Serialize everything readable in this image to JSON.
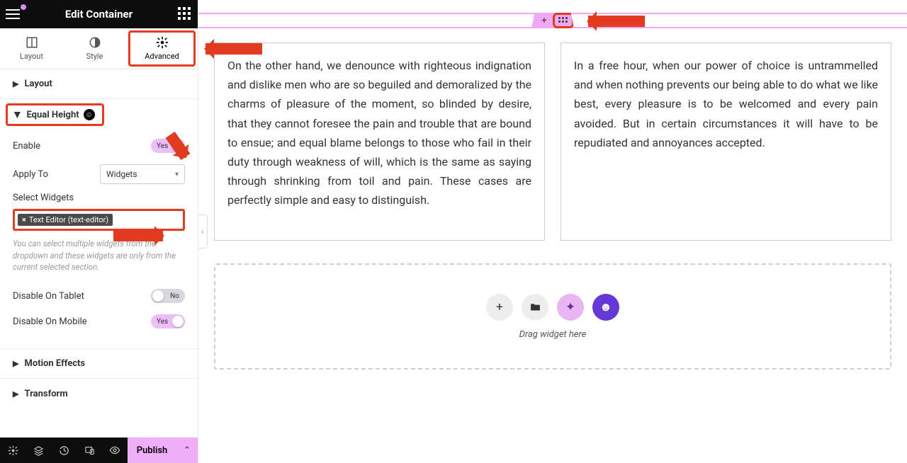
{
  "header": {
    "title": "Edit Container"
  },
  "tabs": {
    "layout": "Layout",
    "style": "Style",
    "advanced": "Advanced",
    "active": "advanced"
  },
  "sections": {
    "layout": "Layout",
    "equal_height": "Equal Height",
    "motion_effects": "Motion Effects",
    "transform": "Transform"
  },
  "equal_height": {
    "enable_label": "Enable",
    "enable_value": "Yes",
    "apply_to_label": "Apply To",
    "apply_to_value": "Widgets",
    "select_widgets_label": "Select Widgets",
    "chip": "Text Editor (text-editor)",
    "help": "You can select multiple widgets from the dropdown and these widgets are only from the current selected section.",
    "disable_tablet_label": "Disable On Tablet",
    "disable_tablet_value": "No",
    "disable_mobile_label": "Disable On Mobile",
    "disable_mobile_value": "Yes"
  },
  "footer": {
    "publish": "Publish"
  },
  "canvas": {
    "card1": "On the other hand, we denounce with righteous indignation and dislike men who are so beguiled and demoralized by the charms of pleasure of the moment, so blinded by desire, that they cannot foresee the pain and trouble that are bound to ensue; and equal blame belongs to those who fail in their duty through weakness of will, which is the same as saying through shrinking from toil and pain. These cases are perfectly simple and easy to distinguish.",
    "card2": "In a free hour, when our power of choice is untrammelled and when nothing prevents our being able to do what we like best, every pleasure is to be welcomed and every pain avoided. But in certain circumstances it will have to be repudiated and annoyances accepted.",
    "drop_hint": "Drag widget here"
  },
  "colors": {
    "accent": "#e23b1f",
    "pink": "#f1a8f4",
    "purple": "#6438d6"
  }
}
